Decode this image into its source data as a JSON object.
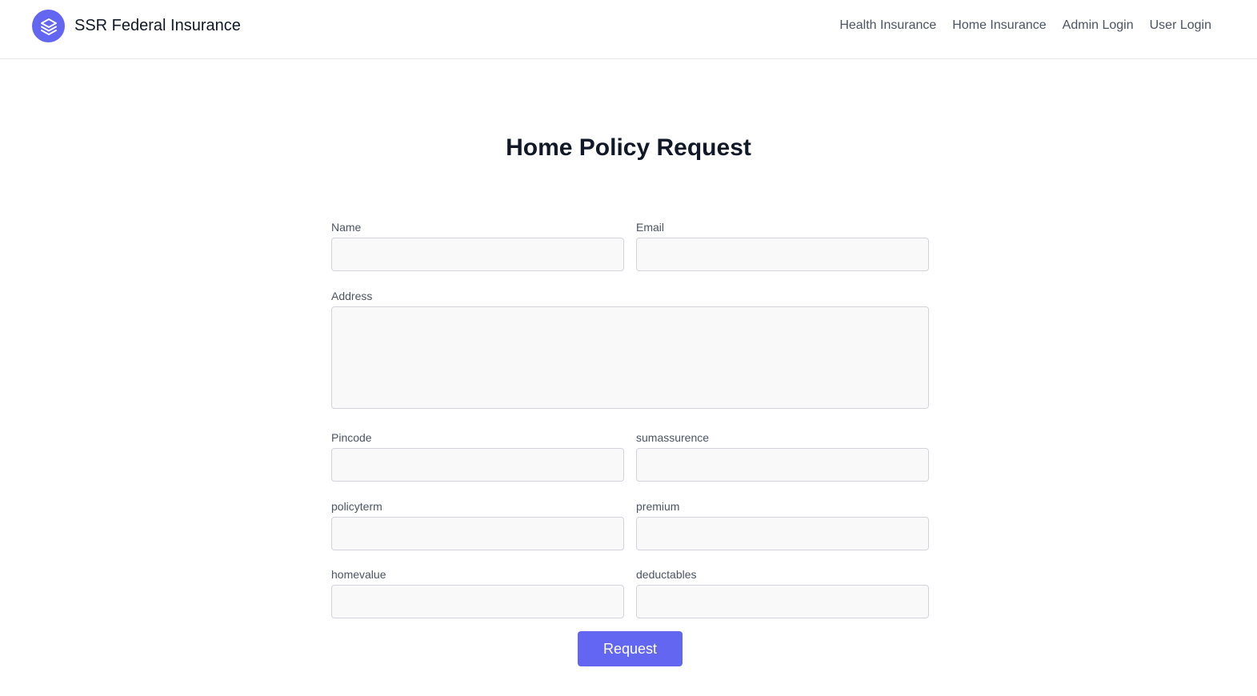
{
  "header": {
    "brand_name": "SSR Federal Insurance",
    "logo_icon": "layers-icon",
    "nav": [
      {
        "label": "Health Insurance"
      },
      {
        "label": "Home Insurance"
      },
      {
        "label": "Admin Login"
      },
      {
        "label": "User Login"
      }
    ]
  },
  "form": {
    "title": "Home Policy Request",
    "fields": {
      "name": {
        "label": "Name",
        "value": ""
      },
      "email": {
        "label": "Email",
        "value": ""
      },
      "address": {
        "label": "Address",
        "value": ""
      },
      "pincode": {
        "label": "Pincode",
        "value": ""
      },
      "sumassurence": {
        "label": "sumassurence",
        "value": ""
      },
      "policyterm": {
        "label": "policyterm",
        "value": ""
      },
      "premium": {
        "label": "premium",
        "value": ""
      },
      "homevalue": {
        "label": "homevalue",
        "value": ""
      },
      "deductables": {
        "label": "deductables",
        "value": ""
      }
    },
    "submit_label": "Request"
  },
  "colors": {
    "accent": "#6366f1",
    "input_bg": "#f9f9f9",
    "border": "#e5e7eb"
  }
}
